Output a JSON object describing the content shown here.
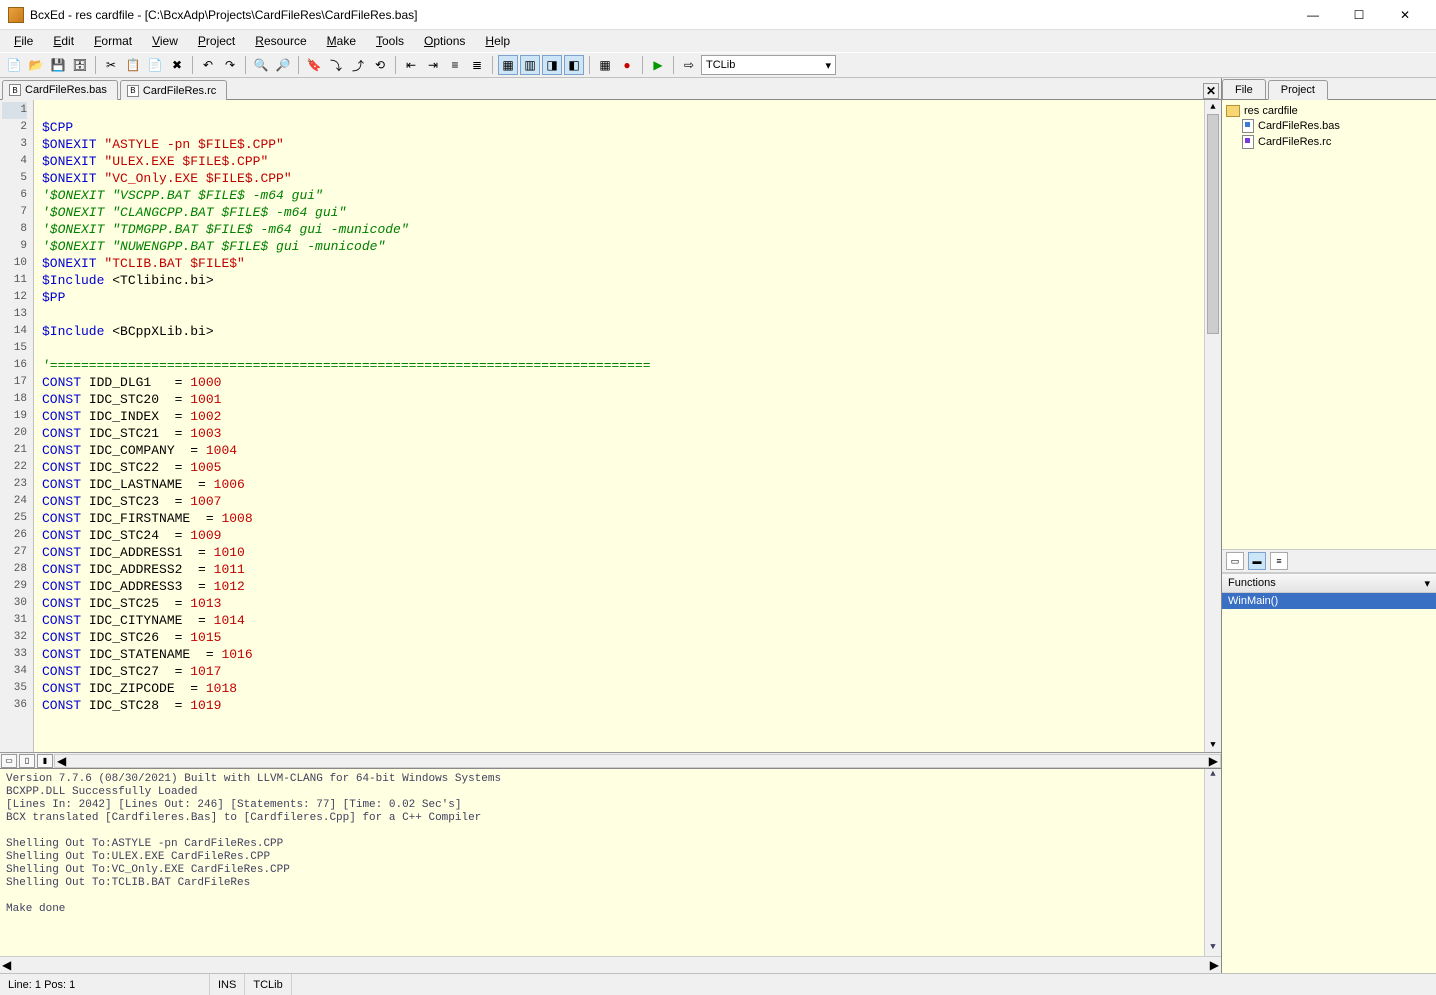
{
  "window": {
    "title": "BcxEd - res cardfile - [C:\\BcxAdp\\Projects\\CardFileRes\\CardFileRes.bas]"
  },
  "menu": {
    "items": [
      "File",
      "Edit",
      "Format",
      "View",
      "Project",
      "Resource",
      "Make",
      "Tools",
      "Options",
      "Help"
    ]
  },
  "toolbar": {
    "compiler": "TCLib"
  },
  "tabs": {
    "items": [
      {
        "label": "CardFileRes.bas",
        "active": true
      },
      {
        "label": "CardFileRes.rc",
        "active": false
      }
    ]
  },
  "code_lines": [
    {
      "n": 1,
      "segs": []
    },
    {
      "n": 2,
      "segs": [
        {
          "c": "dir",
          "t": "$CPP"
        }
      ]
    },
    {
      "n": 3,
      "segs": [
        {
          "c": "dir",
          "t": "$ONEXIT "
        },
        {
          "c": "str",
          "t": "\"ASTYLE -pn $FILE$.CPP\""
        }
      ]
    },
    {
      "n": 4,
      "segs": [
        {
          "c": "dir",
          "t": "$ONEXIT "
        },
        {
          "c": "str",
          "t": "\"ULEX.EXE $FILE$.CPP\""
        }
      ]
    },
    {
      "n": 5,
      "segs": [
        {
          "c": "dir",
          "t": "$ONEXIT "
        },
        {
          "c": "str",
          "t": "\"VC_Only.EXE $FILE$.CPP\""
        }
      ]
    },
    {
      "n": 6,
      "segs": [
        {
          "c": "cmt",
          "t": "'$ONEXIT \"VSCPP.BAT $FILE$ -m64 gui\""
        }
      ]
    },
    {
      "n": 7,
      "segs": [
        {
          "c": "cmt",
          "t": "'$ONEXIT \"CLANGCPP.BAT $FILE$ -m64 gui\""
        }
      ]
    },
    {
      "n": 8,
      "segs": [
        {
          "c": "cmt",
          "t": "'$ONEXIT \"TDMGPP.BAT $FILE$ -m64 gui -municode\""
        }
      ]
    },
    {
      "n": 9,
      "segs": [
        {
          "c": "cmt",
          "t": "'$ONEXIT \"NUWENGPP.BAT $FILE$ gui -municode\""
        }
      ]
    },
    {
      "n": 10,
      "segs": [
        {
          "c": "dir",
          "t": "$ONEXIT "
        },
        {
          "c": "str",
          "t": "\"TCLIB.BAT $FILE$\""
        }
      ]
    },
    {
      "n": 11,
      "segs": [
        {
          "c": "dir",
          "t": "$Include "
        },
        {
          "c": "id",
          "t": "<TClibinc.bi>"
        }
      ]
    },
    {
      "n": 12,
      "segs": [
        {
          "c": "dir",
          "t": "$PP"
        }
      ]
    },
    {
      "n": 13,
      "segs": []
    },
    {
      "n": 14,
      "segs": [
        {
          "c": "dir",
          "t": "$Include "
        },
        {
          "c": "id",
          "t": "<BCppXLib.bi>"
        }
      ]
    },
    {
      "n": 15,
      "segs": []
    },
    {
      "n": 16,
      "segs": [
        {
          "c": "cmt",
          "t": "'============================================================================="
        }
      ]
    },
    {
      "n": 17,
      "segs": [
        {
          "c": "kw",
          "t": "CONST"
        },
        {
          "c": "id",
          "t": " IDD_DLG1   = "
        },
        {
          "c": "num",
          "t": "1000"
        }
      ]
    },
    {
      "n": 18,
      "segs": [
        {
          "c": "kw",
          "t": "CONST"
        },
        {
          "c": "id",
          "t": " IDC_STC20  = "
        },
        {
          "c": "num",
          "t": "1001"
        }
      ]
    },
    {
      "n": 19,
      "segs": [
        {
          "c": "kw",
          "t": "CONST"
        },
        {
          "c": "id",
          "t": " IDC_INDEX  = "
        },
        {
          "c": "num",
          "t": "1002"
        }
      ]
    },
    {
      "n": 20,
      "segs": [
        {
          "c": "kw",
          "t": "CONST"
        },
        {
          "c": "id",
          "t": " IDC_STC21  = "
        },
        {
          "c": "num",
          "t": "1003"
        }
      ]
    },
    {
      "n": 21,
      "segs": [
        {
          "c": "kw",
          "t": "CONST"
        },
        {
          "c": "id",
          "t": " IDC_COMPANY  = "
        },
        {
          "c": "num",
          "t": "1004"
        }
      ]
    },
    {
      "n": 22,
      "segs": [
        {
          "c": "kw",
          "t": "CONST"
        },
        {
          "c": "id",
          "t": " IDC_STC22  = "
        },
        {
          "c": "num",
          "t": "1005"
        }
      ]
    },
    {
      "n": 23,
      "segs": [
        {
          "c": "kw",
          "t": "CONST"
        },
        {
          "c": "id",
          "t": " IDC_LASTNAME  = "
        },
        {
          "c": "num",
          "t": "1006"
        }
      ]
    },
    {
      "n": 24,
      "segs": [
        {
          "c": "kw",
          "t": "CONST"
        },
        {
          "c": "id",
          "t": " IDC_STC23  = "
        },
        {
          "c": "num",
          "t": "1007"
        }
      ]
    },
    {
      "n": 25,
      "segs": [
        {
          "c": "kw",
          "t": "CONST"
        },
        {
          "c": "id",
          "t": " IDC_FIRSTNAME  = "
        },
        {
          "c": "num",
          "t": "1008"
        }
      ]
    },
    {
      "n": 26,
      "segs": [
        {
          "c": "kw",
          "t": "CONST"
        },
        {
          "c": "id",
          "t": " IDC_STC24  = "
        },
        {
          "c": "num",
          "t": "1009"
        }
      ]
    },
    {
      "n": 27,
      "segs": [
        {
          "c": "kw",
          "t": "CONST"
        },
        {
          "c": "id",
          "t": " IDC_ADDRESS1  = "
        },
        {
          "c": "num",
          "t": "1010"
        }
      ]
    },
    {
      "n": 28,
      "segs": [
        {
          "c": "kw",
          "t": "CONST"
        },
        {
          "c": "id",
          "t": " IDC_ADDRESS2  = "
        },
        {
          "c": "num",
          "t": "1011"
        }
      ]
    },
    {
      "n": 29,
      "segs": [
        {
          "c": "kw",
          "t": "CONST"
        },
        {
          "c": "id",
          "t": " IDC_ADDRESS3  = "
        },
        {
          "c": "num",
          "t": "1012"
        }
      ]
    },
    {
      "n": 30,
      "segs": [
        {
          "c": "kw",
          "t": "CONST"
        },
        {
          "c": "id",
          "t": " IDC_STC25  = "
        },
        {
          "c": "num",
          "t": "1013"
        }
      ]
    },
    {
      "n": 31,
      "segs": [
        {
          "c": "kw",
          "t": "CONST"
        },
        {
          "c": "id",
          "t": " IDC_CITYNAME  = "
        },
        {
          "c": "num",
          "t": "1014"
        }
      ]
    },
    {
      "n": 32,
      "segs": [
        {
          "c": "kw",
          "t": "CONST"
        },
        {
          "c": "id",
          "t": " IDC_STC26  = "
        },
        {
          "c": "num",
          "t": "1015"
        }
      ]
    },
    {
      "n": 33,
      "segs": [
        {
          "c": "kw",
          "t": "CONST"
        },
        {
          "c": "id",
          "t": " IDC_STATENAME  = "
        },
        {
          "c": "num",
          "t": "1016"
        }
      ]
    },
    {
      "n": 34,
      "segs": [
        {
          "c": "kw",
          "t": "CONST"
        },
        {
          "c": "id",
          "t": " IDC_STC27  = "
        },
        {
          "c": "num",
          "t": "1017"
        }
      ]
    },
    {
      "n": 35,
      "segs": [
        {
          "c": "kw",
          "t": "CONST"
        },
        {
          "c": "id",
          "t": " IDC_ZIPCODE  = "
        },
        {
          "c": "num",
          "t": "1018"
        }
      ]
    },
    {
      "n": 36,
      "segs": [
        {
          "c": "kw",
          "t": "CONST"
        },
        {
          "c": "id",
          "t": " IDC_STC28  = "
        },
        {
          "c": "num",
          "t": "1019"
        }
      ]
    }
  ],
  "output": {
    "lines": [
      "Version 7.7.6 (08/30/2021) Built with LLVM-CLANG for 64-bit Windows Systems",
      "BCXPP.DLL Successfully Loaded",
      "[Lines In: 2042] [Lines Out: 246] [Statements: 77] [Time: 0.02 Sec's]",
      "BCX translated [Cardfileres.Bas] to [Cardfileres.Cpp] for a C++ Compiler",
      "",
      "Shelling Out To:ASTYLE -pn CardFileRes.CPP",
      "Shelling Out To:ULEX.EXE CardFileRes.CPP",
      "Shelling Out To:VC_Only.EXE CardFileRes.CPP",
      "Shelling Out To:TCLIB.BAT CardFileRes",
      "",
      "Make done"
    ]
  },
  "side": {
    "tabs": {
      "file": "File",
      "project": "Project",
      "active": "project"
    },
    "project_root": "res cardfile",
    "project_files": [
      "CardFileRes.bas",
      "CardFileRes.rc"
    ],
    "func_header": "Functions",
    "functions": [
      "WinMain()"
    ]
  },
  "status": {
    "pos": "Line: 1 Pos: 1",
    "ins": "INS",
    "compiler": "TCLib"
  }
}
